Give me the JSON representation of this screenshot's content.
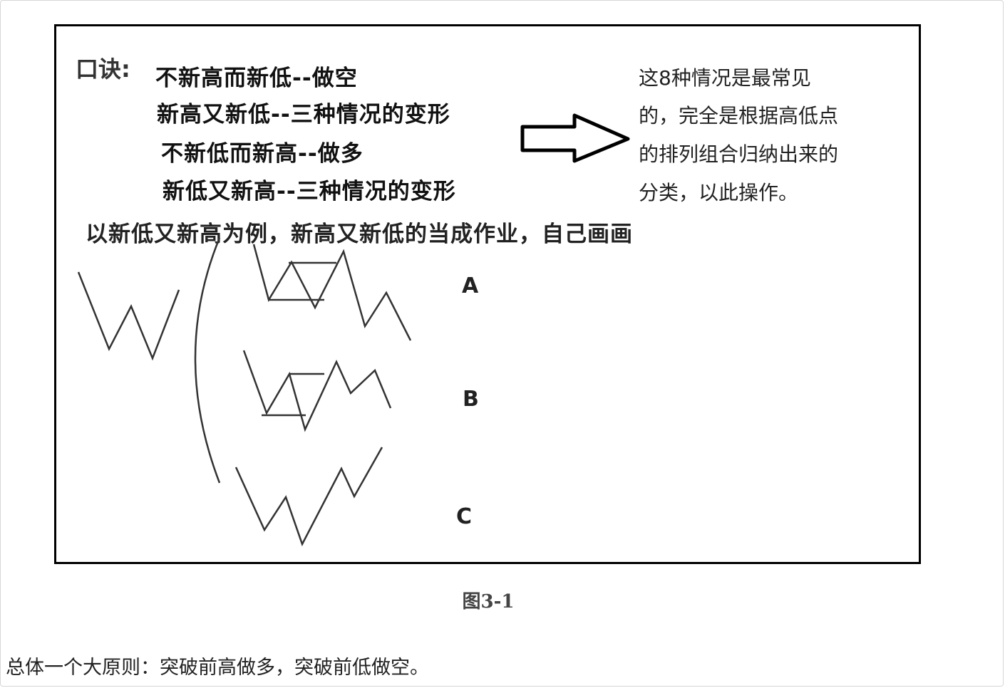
{
  "figure": {
    "mnemonic_label": "口诀:",
    "rules": [
      "不新高而新低--做空",
      "新高又新低--三种情况的变形",
      "不新低而新高--做多",
      "新低又新高--三种情况的变形"
    ],
    "note_lines": [
      "这8种情况是最常见",
      "的，完全是根据高低点",
      "的排列组合归纳出来的",
      "分类，以此操作。"
    ],
    "example_text": "以新低又新高为例，新高又新低的当成作业，自己画画",
    "case_labels": [
      "A",
      "B",
      "C"
    ]
  },
  "caption": "图3-1",
  "principle_text": "总体一个大原则：突破前高做多，突破前低做空。"
}
